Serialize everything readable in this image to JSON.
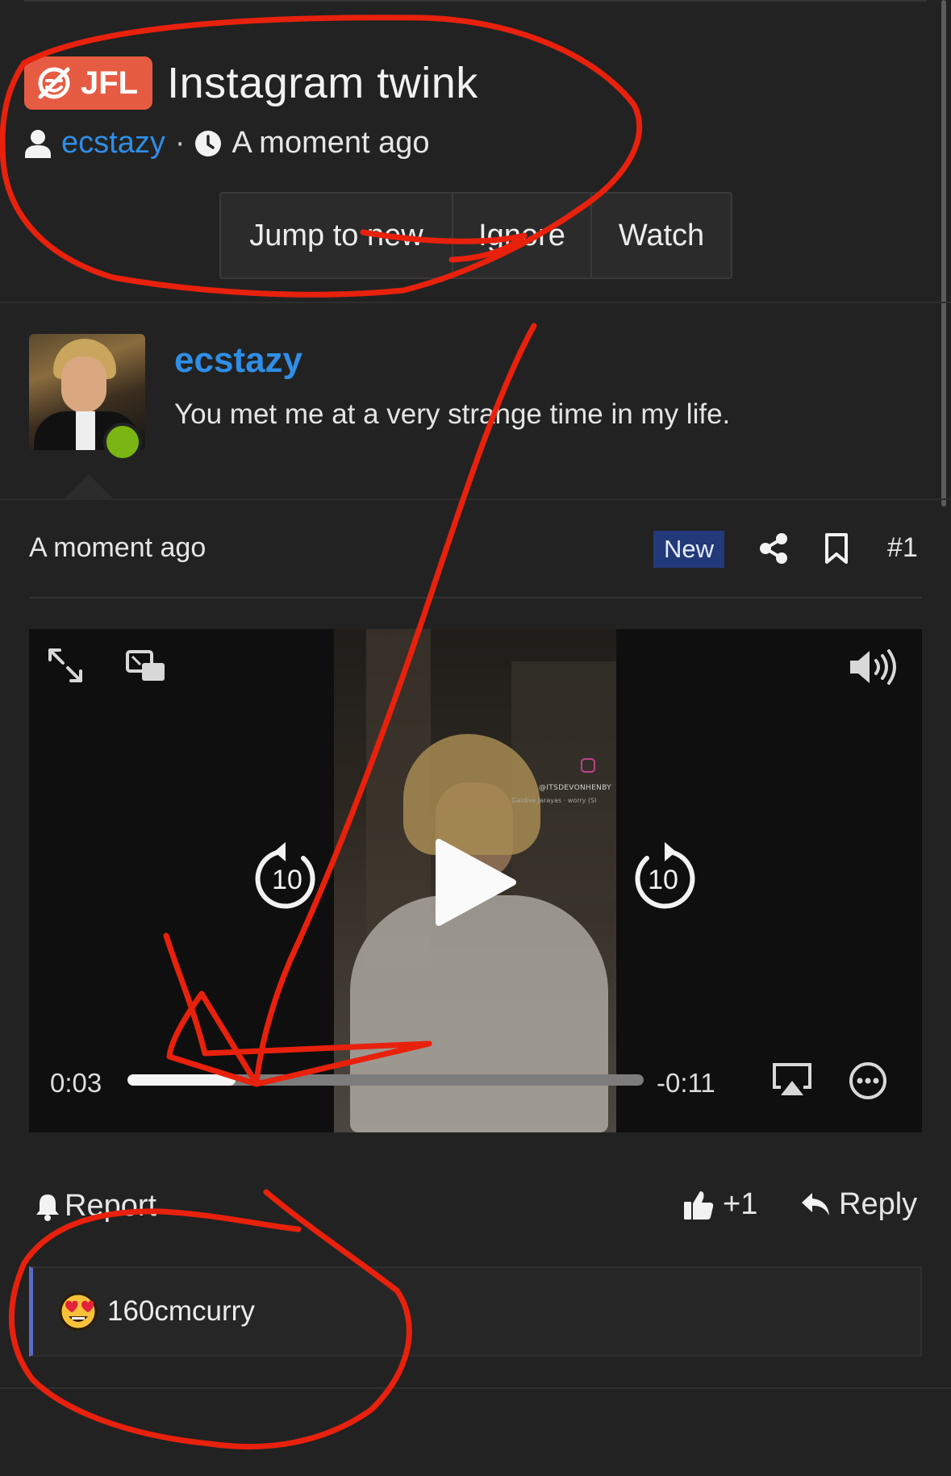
{
  "thread": {
    "prefix": "JFL",
    "title": "Instagram twink",
    "author": "ecstazy",
    "separator": "·",
    "time": "A moment ago"
  },
  "thread_actions": {
    "jump_label": "Jump to new",
    "ignore_label": "Ignore",
    "watch_label": "Watch"
  },
  "post": {
    "author": "ecstazy",
    "user_title": "You met me at a very strange time in my life.",
    "time": "A moment ago",
    "new_badge": "New",
    "number": "#1"
  },
  "video": {
    "current_time": "0:03",
    "remaining_time": "-0:11",
    "progress": 0.21,
    "skip_seconds": "10",
    "watermark_handle": "@ITSDEVONHENBY",
    "watermark_sub": "Galdive Jarayas · worry (Sl"
  },
  "post_footer": {
    "report_label": "Report",
    "like_label": "+1",
    "reply_label": "Reply"
  },
  "reactions": {
    "emoji": "heart-eyes",
    "user": "160cmcurry"
  },
  "colors": {
    "background": "#222222",
    "link": "#2f8ee6",
    "prefix_badge": "#e65c43",
    "new_badge": "#223a7a",
    "online": "#7ab613",
    "reaction_accent": "#5c6ac4",
    "annotation": "#e8210d"
  }
}
